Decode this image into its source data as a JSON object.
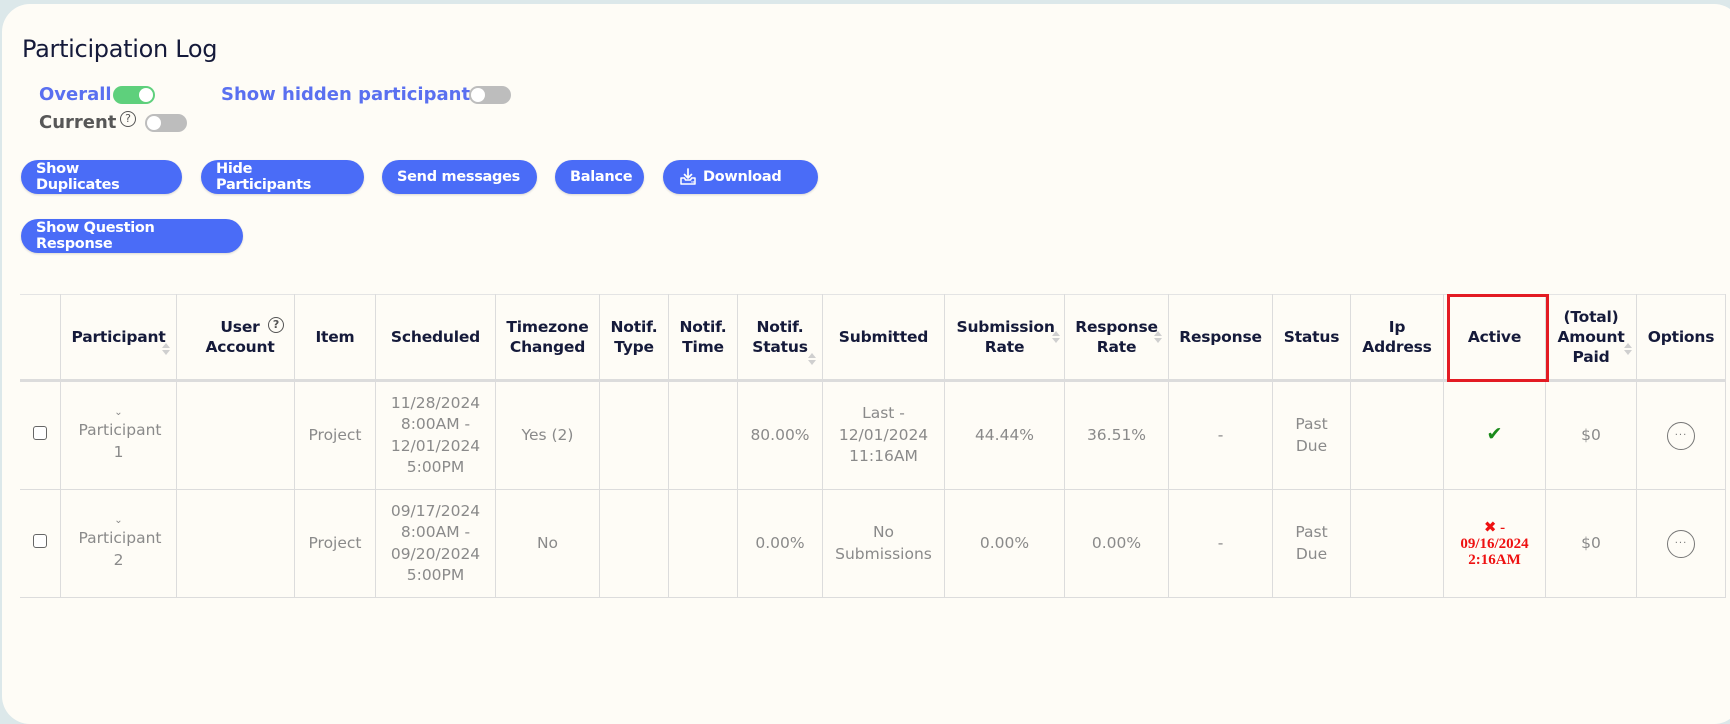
{
  "page": {
    "title": "Participation Log"
  },
  "toggles": {
    "overall": {
      "label": "Overall",
      "on": true
    },
    "current": {
      "label": "Current",
      "on": false,
      "help_icon": "question-circle-icon"
    },
    "show_hidden": {
      "label": "Show hidden participants",
      "on": false
    }
  },
  "toolbar": {
    "show_duplicates": "Show Duplicates",
    "hide_participants": "Hide Participants",
    "send_messages": "Send messages",
    "balance": "Balance",
    "download": "Download",
    "download_icon": "download-tray-icon",
    "show_question_response": "Show Question Response"
  },
  "table": {
    "columns": [
      {
        "key": "select",
        "label": ""
      },
      {
        "key": "participant",
        "label": "Participant",
        "sortable": true
      },
      {
        "key": "user_account",
        "label": "User Account",
        "help": true
      },
      {
        "key": "item",
        "label": "Item"
      },
      {
        "key": "scheduled",
        "label": "Scheduled"
      },
      {
        "key": "timezone_changed",
        "label": "Timezone Changed"
      },
      {
        "key": "notif_type",
        "label": "Notif. Type"
      },
      {
        "key": "notif_time",
        "label": "Notif. Time"
      },
      {
        "key": "notif_status",
        "label": "Notif. Status",
        "sortable": true
      },
      {
        "key": "submitted",
        "label": "Submitted"
      },
      {
        "key": "submission_rate",
        "label": "Submission Rate",
        "sortable": true
      },
      {
        "key": "response_rate",
        "label": "Response Rate",
        "sortable": true
      },
      {
        "key": "response",
        "label": "Response"
      },
      {
        "key": "status",
        "label": "Status"
      },
      {
        "key": "ip_address",
        "label": "Ip Address"
      },
      {
        "key": "active",
        "label": "Active",
        "highlighted": true
      },
      {
        "key": "amount_paid",
        "label": "(Total) Amount Paid",
        "sortable": true
      },
      {
        "key": "options",
        "label": "Options"
      }
    ],
    "rows": [
      {
        "participant": "Participant 1",
        "user_account": "",
        "item": "Project",
        "scheduled": "11/28/2024 8:00AM - 12/01/2024 5:00PM",
        "timezone_changed": "Yes (2)",
        "notif_type": "",
        "notif_time": "",
        "notif_status": "80.00%",
        "submitted": "Last - 12/01/2024 11:16AM",
        "submission_rate": "44.44%",
        "response_rate": "36.51%",
        "response": "-",
        "status": "Past Due",
        "ip_address": "",
        "active": {
          "state": true,
          "icon": "checkmark-icon",
          "text": ""
        },
        "amount_paid": "$0",
        "options_icon": "ellipsis-icon"
      },
      {
        "participant": "Participant 2",
        "user_account": "",
        "item": "Project",
        "scheduled": "09/17/2024 8:00AM - 09/20/2024 5:00PM",
        "timezone_changed": "No",
        "notif_type": "",
        "notif_time": "",
        "notif_status": "0.00%",
        "submitted": "No Submissions",
        "submission_rate": "0.00%",
        "response_rate": "0.00%",
        "response": "-",
        "status": "Past Due",
        "ip_address": "",
        "active": {
          "state": false,
          "icon": "x-icon",
          "text": "- 09/16/2024 2:16AM"
        },
        "amount_paid": "$0",
        "options_icon": "ellipsis-icon"
      }
    ]
  },
  "colors": {
    "accent": "#4a6cf7",
    "toggle_on": "#5ed07c",
    "active_check": "#1a8a1a",
    "inactive_red": "#ee1111",
    "highlight_box": "#e31b23"
  }
}
